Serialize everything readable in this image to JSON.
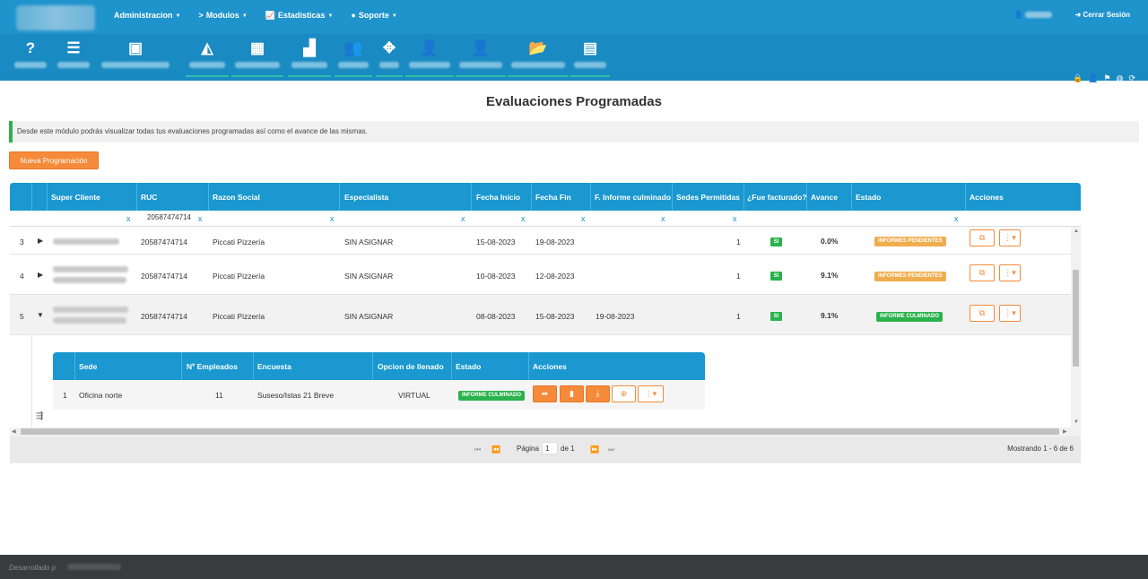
{
  "topnav": {
    "items": [
      {
        "label": "Administracion",
        "icon": "",
        "dropdown": true
      },
      {
        "label": "Modulos",
        "icon": ">",
        "dropdown": true
      },
      {
        "label": "Estadisticas",
        "icon": "chart-icon",
        "dropdown": true
      },
      {
        "label": "Soporte",
        "icon": "info-icon",
        "dropdown": true
      }
    ],
    "logout": "Cerrar Sesión"
  },
  "page": {
    "title": "Evaluaciones Programadas",
    "info": "Desde este módulo podrás visualizar todas tus evaluaciones programadas así como el avance de las mismas.",
    "new_button": "Nueva Programación"
  },
  "grid": {
    "columns": [
      "Super Cliente",
      "RUC",
      "Razon Social",
      "Especialista",
      "Fecha Inicio",
      "Fecha Fin",
      "F. Informe culminado",
      "Sedes Permitidas",
      "¿Fue facturado?",
      "Avance",
      "Estado",
      "Acciones"
    ],
    "filter_clear": "x",
    "filter_ruc": "20587474714",
    "rows": [
      {
        "n": "3",
        "ruc": "20587474714",
        "razon": "Piccati Pizzería",
        "especialista": "SIN ASIGNAR",
        "inicio": "15-08-2023",
        "fin": "19-08-2023",
        "culminado": "",
        "sedes": "1",
        "facturado": "SI",
        "avance": "0.0%",
        "estado": "INFORMES PENDIENTES"
      },
      {
        "n": "4",
        "ruc": "20587474714",
        "razon": "Piccati Pizzería",
        "especialista": "SIN ASIGNAR",
        "inicio": "10-08-2023",
        "fin": "12-08-2023",
        "culminado": "",
        "sedes": "1",
        "facturado": "SI",
        "avance": "9.1%",
        "estado": "INFORMES PENDIENTES"
      },
      {
        "n": "5",
        "ruc": "20587474714",
        "razon": "Piccati Pizzería",
        "especialista": "SIN ASIGNAR",
        "inicio": "08-08-2023",
        "fin": "15-08-2023",
        "culminado": "19-08-2023",
        "sedes": "1",
        "facturado": "SI",
        "avance": "9.1%",
        "estado": "INFORME CULMINADO"
      }
    ],
    "subgrid": {
      "columns": [
        "Sede",
        "Nº Empleados",
        "Encuesta",
        "Opcion de llenado",
        "Estado",
        "Acciones"
      ],
      "row": {
        "n": "1",
        "sede": "Oficina norte",
        "empleados": "11",
        "encuesta": "Suseso/Istas 21 Breve",
        "opcion": "VIRTUAL",
        "estado": "INFORME CULMINADO"
      }
    }
  },
  "pager": {
    "page_label": "Página",
    "page_value": "1",
    "of_label": "de 1",
    "showing": "Mostrando 1 - 6 de 6"
  },
  "footer": {
    "text": "Desarrollado p"
  },
  "colors": {
    "primary": "#1f93cc",
    "header": "#1a98cf",
    "accent": "#f58a3a",
    "success": "#2bb24c",
    "warning": "#f0ad4e"
  }
}
